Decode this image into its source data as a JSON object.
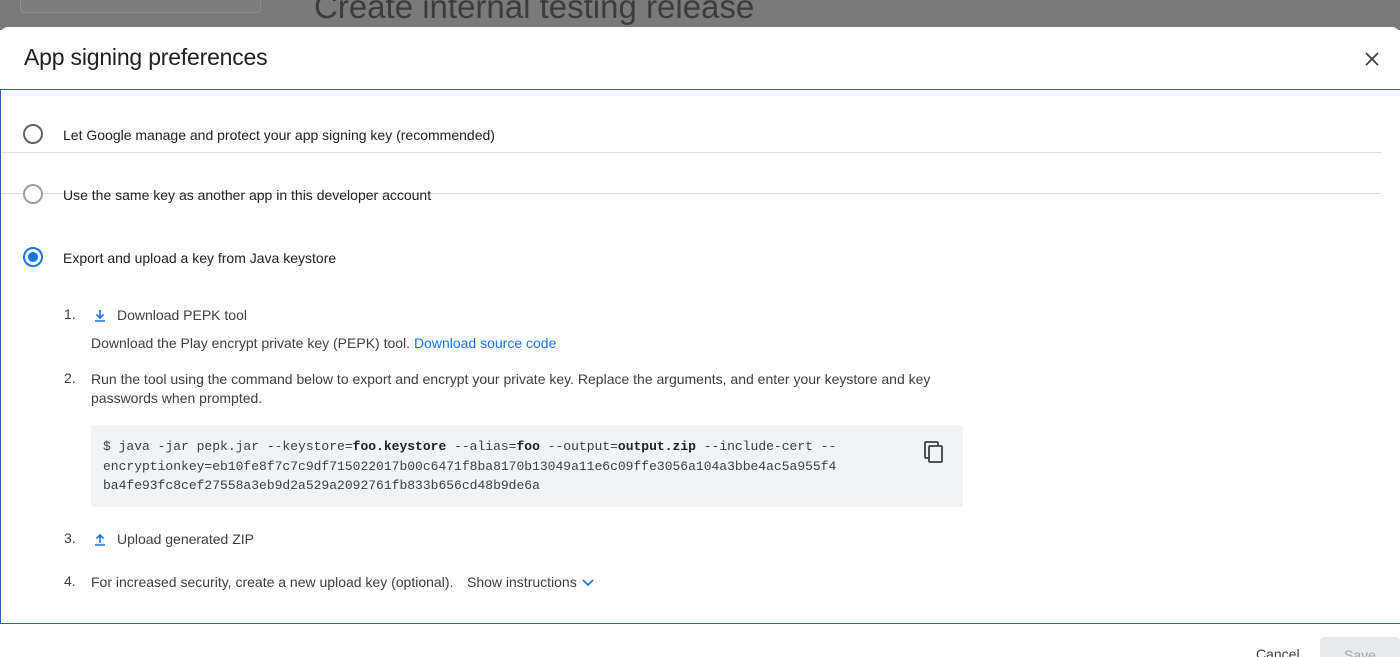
{
  "background": {
    "title": "Create internal testing release"
  },
  "dialog": {
    "title": "App signing preferences",
    "close_icon": "close-icon"
  },
  "options": [
    {
      "label": "Let Google manage and protect your app signing key (recommended)",
      "selected": false
    },
    {
      "label": "Use the same key as another app in this developer account",
      "selected": false
    },
    {
      "label": "Export and upload a key from Java keystore",
      "selected": true
    }
  ],
  "steps": {
    "step1": {
      "num": "1.",
      "link": "Download PEPK tool",
      "icon": "download-icon",
      "desc": "Download the Play encrypt private key (PEPK) tool.",
      "desc_link": "Download source code"
    },
    "step2": {
      "num": "2.",
      "text": "Run the tool using the command below to export and encrypt your private key. Replace the arguments, and enter your keystore and key passwords when prompted."
    },
    "command": {
      "line1_a": "$ java -jar pepk.jar --keystore=",
      "line1_b": "foo.keystore",
      "line1_c": " --alias=",
      "line1_d": "foo",
      "line1_e": " --output=",
      "line1_f": "output.zip",
      "line1_g": " --include-cert --",
      "line2": "encryptionkey=eb10fe8f7c7c9df715022017b00c6471f8ba8170b13049a11e6c09ffe3056a104a3bbe4ac5a955f4",
      "line3": "ba4fe93fc8cef27558a3eb9d2a529a2092761fb833b656cd48b9de6a",
      "copy_icon": "copy-icon"
    },
    "step3": {
      "num": "3.",
      "link": "Upload generated ZIP",
      "icon": "upload-icon"
    },
    "step4": {
      "num": "4.",
      "text": "For increased security, create a new upload key (optional).",
      "link": "Show instructions",
      "icon": "chevron-down-icon"
    }
  },
  "footer": {
    "cancel": "Cancel",
    "save": "Save"
  },
  "colors": {
    "accent": "#1a73e8",
    "border_focus": "#2c5fb2",
    "divider": "#dadce0",
    "code_bg": "#f1f3f4"
  }
}
